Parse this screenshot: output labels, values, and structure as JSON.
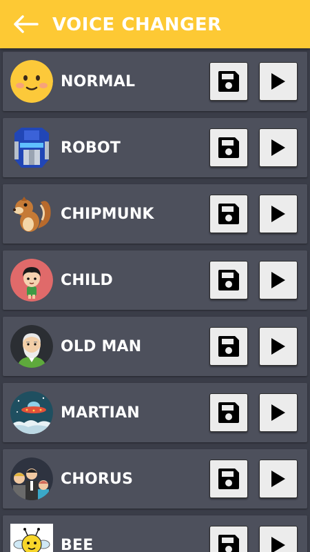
{
  "header": {
    "title": "VOICE CHANGER",
    "back_icon": "arrow-left-icon"
  },
  "colors": {
    "appbar": "#fdc934",
    "background": "#3a3d48",
    "row": "#4d505c",
    "button": "#ececec"
  },
  "voices": [
    {
      "id": "normal",
      "label": "NORMAL",
      "icon": "smiley-face-icon"
    },
    {
      "id": "robot",
      "label": "ROBOT",
      "icon": "robot-head-icon"
    },
    {
      "id": "chipmunk",
      "label": "CHIPMUNK",
      "icon": "chipmunk-icon"
    },
    {
      "id": "child",
      "label": "CHILD",
      "icon": "child-icon"
    },
    {
      "id": "old-man",
      "label": "OLD MAN",
      "icon": "old-man-icon"
    },
    {
      "id": "martian",
      "label": "MARTIAN",
      "icon": "ufo-icon"
    },
    {
      "id": "chorus",
      "label": "CHORUS",
      "icon": "group-people-icon"
    },
    {
      "id": "bee",
      "label": "BEE",
      "icon": "bee-icon"
    }
  ],
  "actions": {
    "save_icon": "save-icon",
    "play_icon": "play-icon"
  }
}
